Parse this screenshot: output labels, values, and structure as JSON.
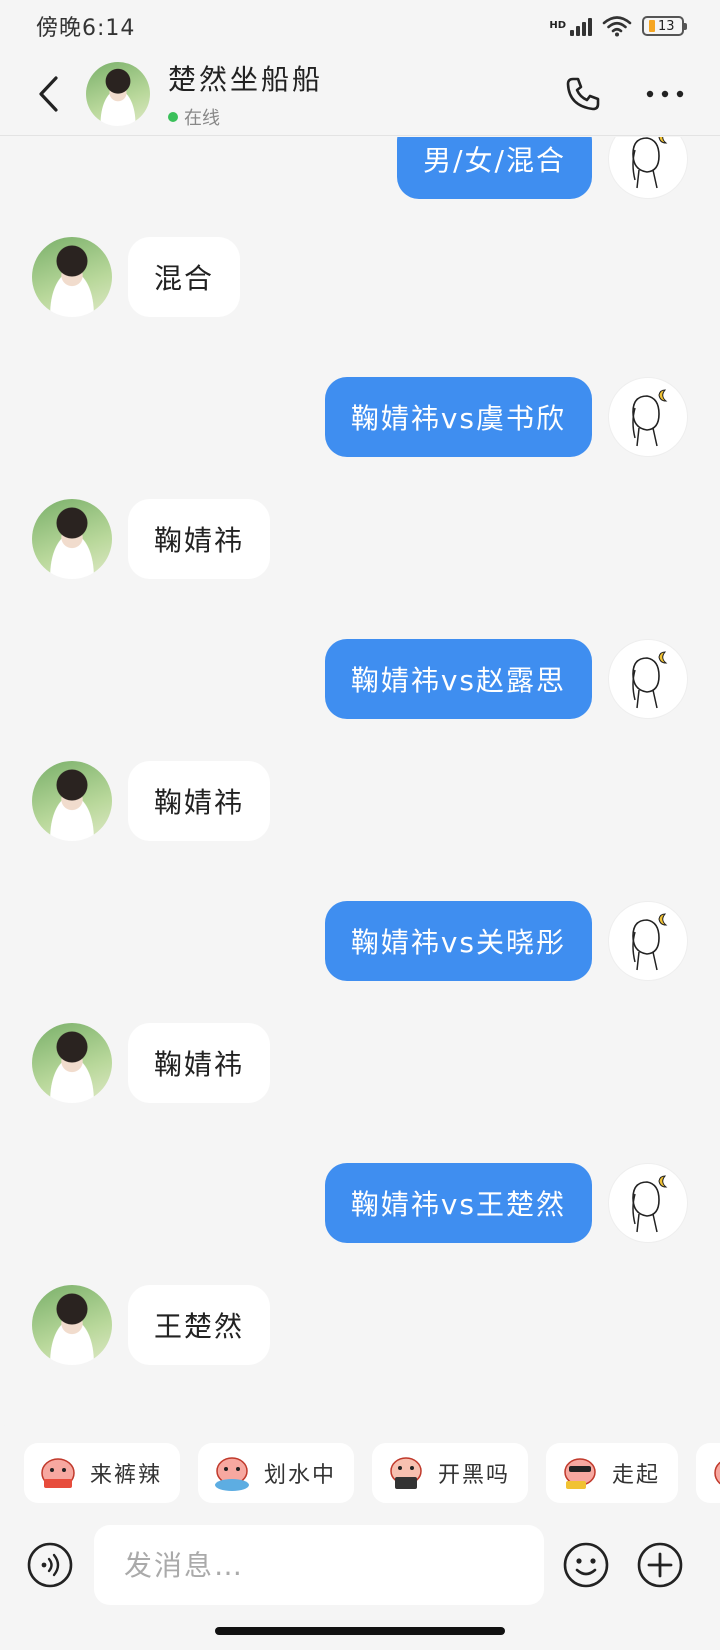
{
  "status_bar": {
    "time": "傍晚6:14",
    "network_badge": "HD",
    "battery_level": "13"
  },
  "header": {
    "title": "楚然坐船船",
    "status_text": "在线",
    "back_icon": "chevron-left-icon",
    "call_icon": "phone-icon",
    "more_icon": "more-horizontal-icon",
    "presence_color": "#3ac05a"
  },
  "messages": [
    {
      "direction": "out",
      "text": "男/女/混合"
    },
    {
      "direction": "in",
      "text": "混合"
    },
    {
      "direction": "out",
      "text": "鞠婧祎vs虞书欣"
    },
    {
      "direction": "in",
      "text": "鞠婧祎"
    },
    {
      "direction": "out",
      "text": "鞠婧祎vs赵露思"
    },
    {
      "direction": "in",
      "text": "鞠婧祎"
    },
    {
      "direction": "out",
      "text": "鞠婧祎vs关晓彤"
    },
    {
      "direction": "in",
      "text": "鞠婧祎"
    },
    {
      "direction": "out",
      "text": "鞠婧祎vs王楚然"
    },
    {
      "direction": "in",
      "text": "王楚然"
    }
  ],
  "quick_replies": [
    {
      "label": "来裤辣",
      "icon": "sticker-icon"
    },
    {
      "label": "划水中",
      "icon": "sticker-icon"
    },
    {
      "label": "开黑吗",
      "icon": "sticker-icon"
    },
    {
      "label": "走起",
      "icon": "sticker-icon"
    }
  ],
  "input": {
    "placeholder": "发消息…",
    "value": ""
  },
  "colors": {
    "outgoing_bubble": "#3f8ef0",
    "incoming_bubble": "#ffffff",
    "background": "#f5f5f5"
  }
}
